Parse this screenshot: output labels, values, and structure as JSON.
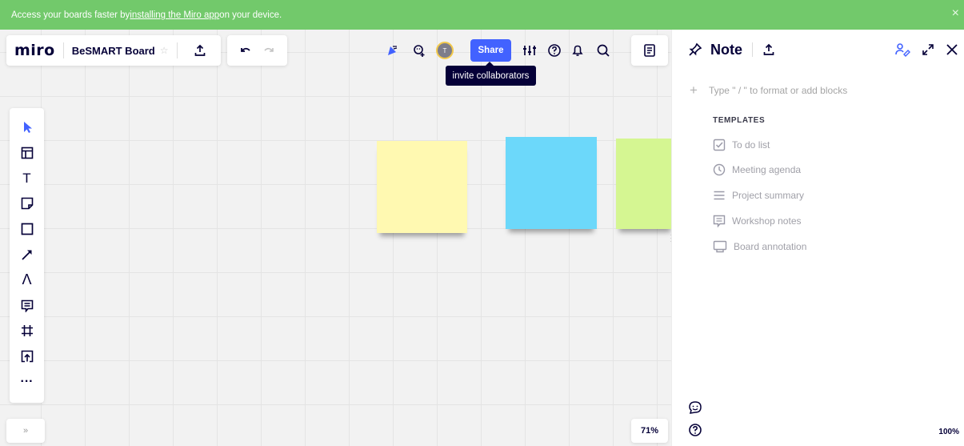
{
  "banner": {
    "text_before": "Access your boards faster by ",
    "link_text": "installing the Miro app",
    "text_after": " on your device.",
    "close_symbol": "×",
    "color": "#72c96b"
  },
  "header": {
    "logo": "miro",
    "board_title": "BeSMART Board",
    "star_symbol": "☆",
    "avatar_initial": "T",
    "share_label": "Share",
    "tooltip": "invite collaborators"
  },
  "toolbar": {
    "tools": [
      "select-icon",
      "templates-icon",
      "text-icon",
      "sticky-note-icon",
      "shape-icon",
      "line-icon",
      "pen-icon",
      "comment-icon",
      "frame-icon",
      "upload-icon",
      "more-icon"
    ],
    "text_tool_glyph": "T",
    "pen_tool_glyph": "Λ",
    "more_glyph": "···"
  },
  "canvas": {
    "expand_glyph": "»",
    "zoom": "71%",
    "stickies": [
      {
        "color": "#fff9b1"
      },
      {
        "color": "#6cd8fa"
      },
      {
        "color": "#d5f692"
      }
    ]
  },
  "note_panel": {
    "title": "Note",
    "placeholder": "Type \" / \" to format or add blocks",
    "templates_label": "TEMPLATES",
    "templates": [
      {
        "label": "To do list",
        "icon": "checkbox-icon"
      },
      {
        "label": "Meeting agenda",
        "icon": "clock-icon"
      },
      {
        "label": "Project summary",
        "icon": "lines-icon"
      },
      {
        "label": "Workshop notes",
        "icon": "notes-icon"
      },
      {
        "label": "Board annotation",
        "icon": "board-icon"
      }
    ],
    "zoom": "100%"
  },
  "colors": {
    "accent": "#4262ff",
    "text": "#050038"
  }
}
